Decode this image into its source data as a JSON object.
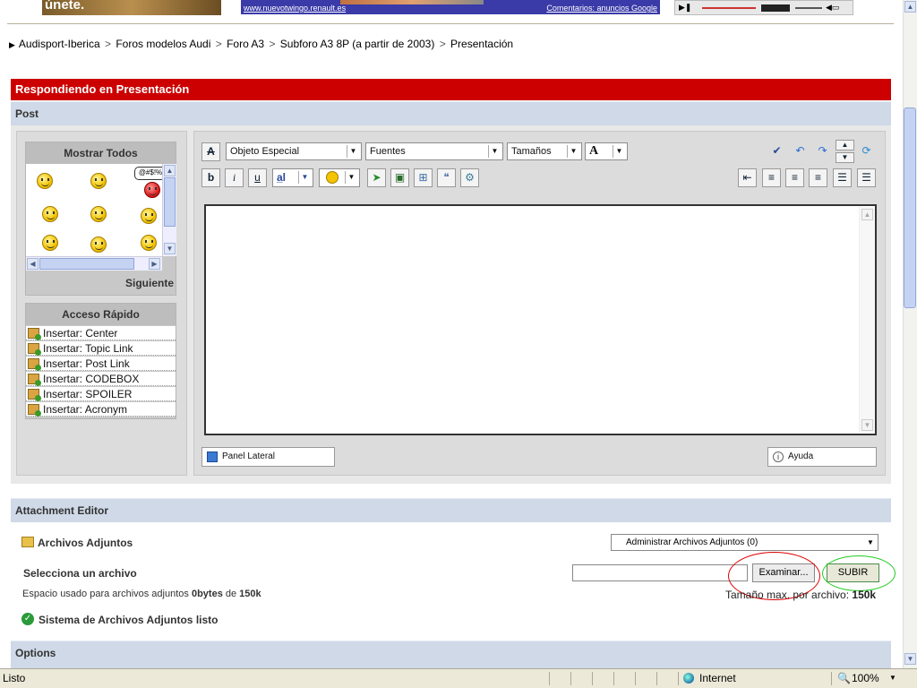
{
  "ads": {
    "left_text": "únete.",
    "mid_url": "www.nuevotwingo.renault.es",
    "mid_ads": "Comentarios: anuncios Google"
  },
  "breadcrumb": [
    "Audisport-Iberica",
    "Foros modelos Audi",
    "Foro A3",
    "Subforo A3 8P (a partir de 2003)",
    "Presentación"
  ],
  "header": {
    "title": "Respondiendo en Presentación"
  },
  "post": {
    "label": "Post"
  },
  "smilies": {
    "title": "Mostrar Todos",
    "next": "Siguiente",
    "speech": "@#$!%"
  },
  "quick_access": {
    "title": "Acceso Rápido",
    "items": [
      "Insertar: Center",
      "Insertar: Topic Link",
      "Insertar: Post Link",
      "Insertar: CODEBOX",
      "Insertar: SPOILER",
      "Insertar: Acronym"
    ]
  },
  "editor": {
    "special_object": "Objeto Especial",
    "fonts": "Fuentes",
    "sizes": "Tamaños",
    "color_label": "A",
    "side_panel": "Panel Lateral",
    "help": "Ayuda"
  },
  "attachment": {
    "bar_label": "Attachment Editor",
    "files_label": "Archivos Adjuntos",
    "manage_select": "Administrar Archivos Adjuntos (0)",
    "select_label": "Selecciona un archivo",
    "browse_button": "Examinar...",
    "upload_button": "SUBIR",
    "space_prefix": "Espacio usado para archivos adjuntos ",
    "space_used": "0bytes",
    "space_of": " de ",
    "space_total": "150k",
    "max_prefix": "Tamaño max. por archivo: ",
    "max_size": "150k",
    "system_ready": "Sistema de Archivos Adjuntos listo"
  },
  "options": {
    "label": "Options"
  },
  "status_bar": {
    "left": "Listo",
    "zone": "Internet",
    "zoom": "100%"
  },
  "colors": {
    "red_header": "#cc0000",
    "section_bar": "#cfd9e7",
    "panel_bg": "#dcdcdc",
    "status_bg": "#ece9d8",
    "annotation_red": "#dd0000",
    "annotation_green": "#22cc22"
  }
}
